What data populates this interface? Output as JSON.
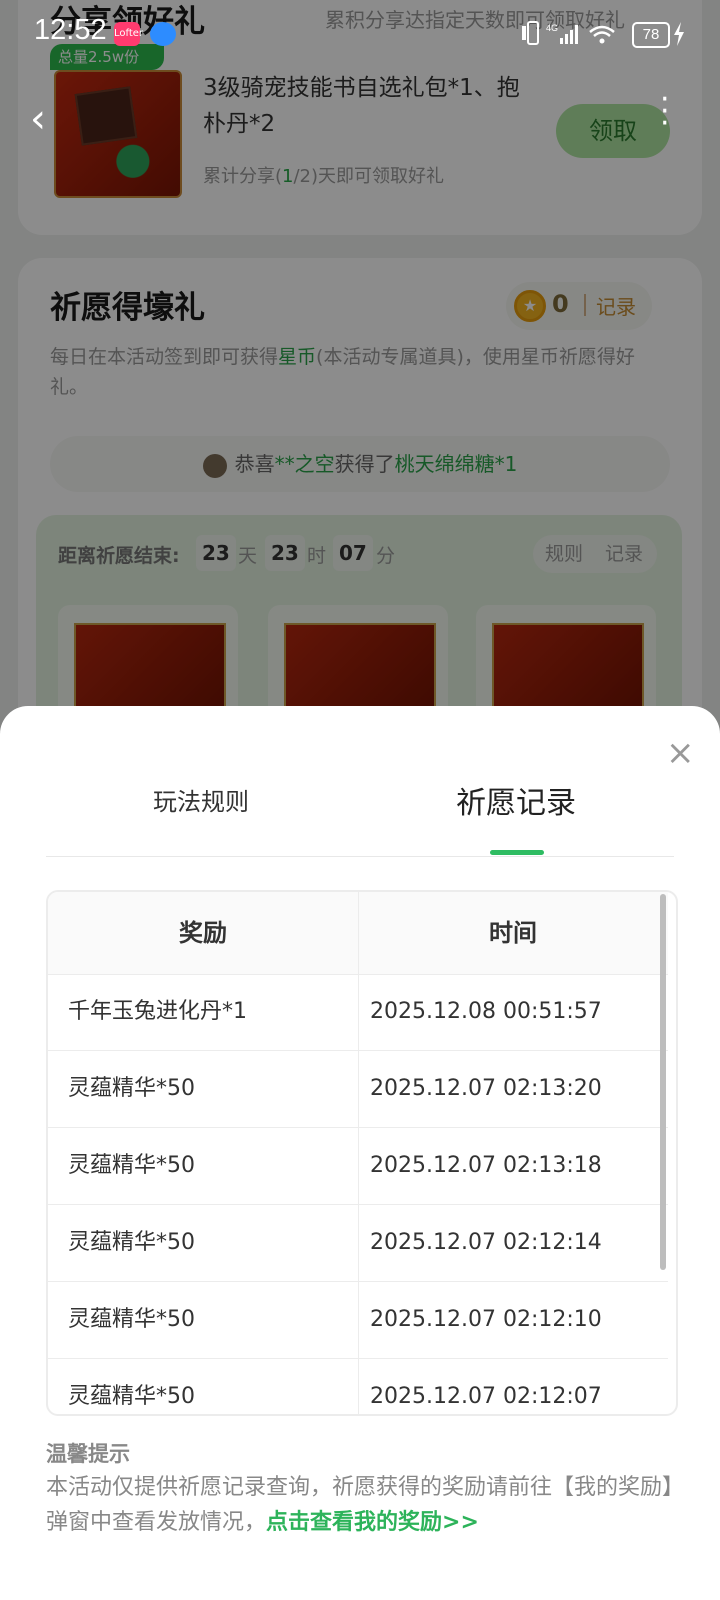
{
  "status_bar": {
    "time": "12:52",
    "app1_label": "Lofter",
    "network": "4G",
    "battery": "78"
  },
  "share_section": {
    "title": "分享领好礼",
    "subtitle": "累积分享达指定天数即可领取好礼",
    "total_badge": "总量2.5w份",
    "gift_name": "3级骑宠技能书自选礼包*1、抱朴丹*2",
    "progress_prefix": "累计分享(",
    "progress_current": "1",
    "progress_suffix": "/2)天即可领取好礼",
    "claim_label": "领取"
  },
  "pray_section": {
    "title": "祈愿得壕礼",
    "coin_count": "0",
    "coin_record": "记录",
    "desc_prefix": "每日在本活动签到即可获得",
    "desc_highlight": "星币",
    "desc_suffix": "(本活动专属道具)，使用星币祈愿得好礼。",
    "winner_prefix": "恭喜",
    "winner_name": "**之空",
    "winner_mid": "获得了",
    "winner_prize": "桃天绵绵糖*1",
    "countdown_label": "距离祈愿结束:",
    "days": "23",
    "days_unit": "天",
    "hours": "23",
    "hours_unit": "时",
    "minutes": "07",
    "minutes_unit": "分",
    "rules_link": "规则",
    "record_link": "记录"
  },
  "modal": {
    "tabs": [
      {
        "label": "玩法规则",
        "active": false
      },
      {
        "label": "祈愿记录",
        "active": true
      }
    ],
    "table": {
      "headers": [
        "奖励",
        "时间"
      ],
      "rows": [
        {
          "reward": "千年玉兔进化丹*1",
          "time": "2025.12.08 00:51:57"
        },
        {
          "reward": "灵蕴精华*50",
          "time": "2025.12.07 02:13:20"
        },
        {
          "reward": "灵蕴精华*50",
          "time": "2025.12.07 02:13:18"
        },
        {
          "reward": "灵蕴精华*50",
          "time": "2025.12.07 02:12:14"
        },
        {
          "reward": "灵蕴精华*50",
          "time": "2025.12.07 02:12:10"
        },
        {
          "reward": "灵蕴精华*50",
          "time": "2025.12.07 02:12:07"
        }
      ]
    },
    "tips_title": "温馨提示",
    "tips_body": "本活动仅提供祈愿记录查询，祈愿获得的奖励请前往【我的奖励】弹窗中查看发放情况，",
    "tips_link": "点击查看我的奖励>>"
  },
  "colors": {
    "accent_green": "#2ebc62",
    "coin_gold": "#f2b320"
  },
  "icons": [
    "back-arrow-icon",
    "more-icon",
    "close-icon",
    "coin-icon",
    "avatar-icon"
  ]
}
